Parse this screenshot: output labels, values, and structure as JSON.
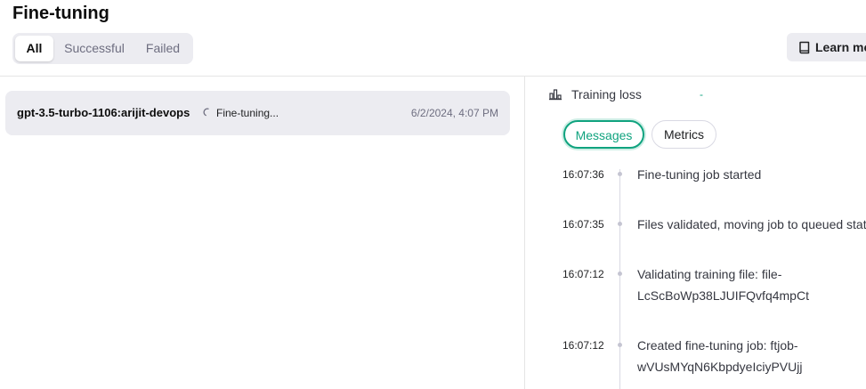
{
  "header": {
    "title": "Fine-tuning",
    "learn_more_label": "Learn more"
  },
  "filters": {
    "tabs": [
      "All",
      "Successful",
      "Failed"
    ],
    "active": "All"
  },
  "jobs": [
    {
      "name": "gpt-3.5-turbo-1106:arijit-devops",
      "status": "Fine-tuning...",
      "created": "6/2/2024, 4:07 PM"
    }
  ],
  "detail": {
    "training_loss_label": "Training loss",
    "training_loss_value": "-",
    "tabs": {
      "messages": "Messages",
      "metrics": "Metrics",
      "active": "Messages"
    },
    "messages": [
      {
        "time": "16:07:36",
        "lines": [
          "Fine-tuning job started"
        ]
      },
      {
        "time": "16:07:35",
        "lines": [
          "Files validated, moving job to queued state"
        ]
      },
      {
        "time": "16:07:12",
        "lines": [
          "Validating training file: file-",
          "LcScBoWp38LJUIFQvfq4mpCt"
        ]
      },
      {
        "time": "16:07:12",
        "lines": [
          "Created fine-tuning job: ftjob-",
          "wVUsMYqN6KbpdyeIciyPVUjj"
        ]
      }
    ]
  },
  "icons": {
    "book": "book-icon",
    "chart": "bar-chart-icon",
    "spinner": "spinner-icon"
  },
  "colors": {
    "accent": "#10a37f",
    "surface": "#ececf1",
    "text": "#202123",
    "muted": "#6e6e80"
  }
}
